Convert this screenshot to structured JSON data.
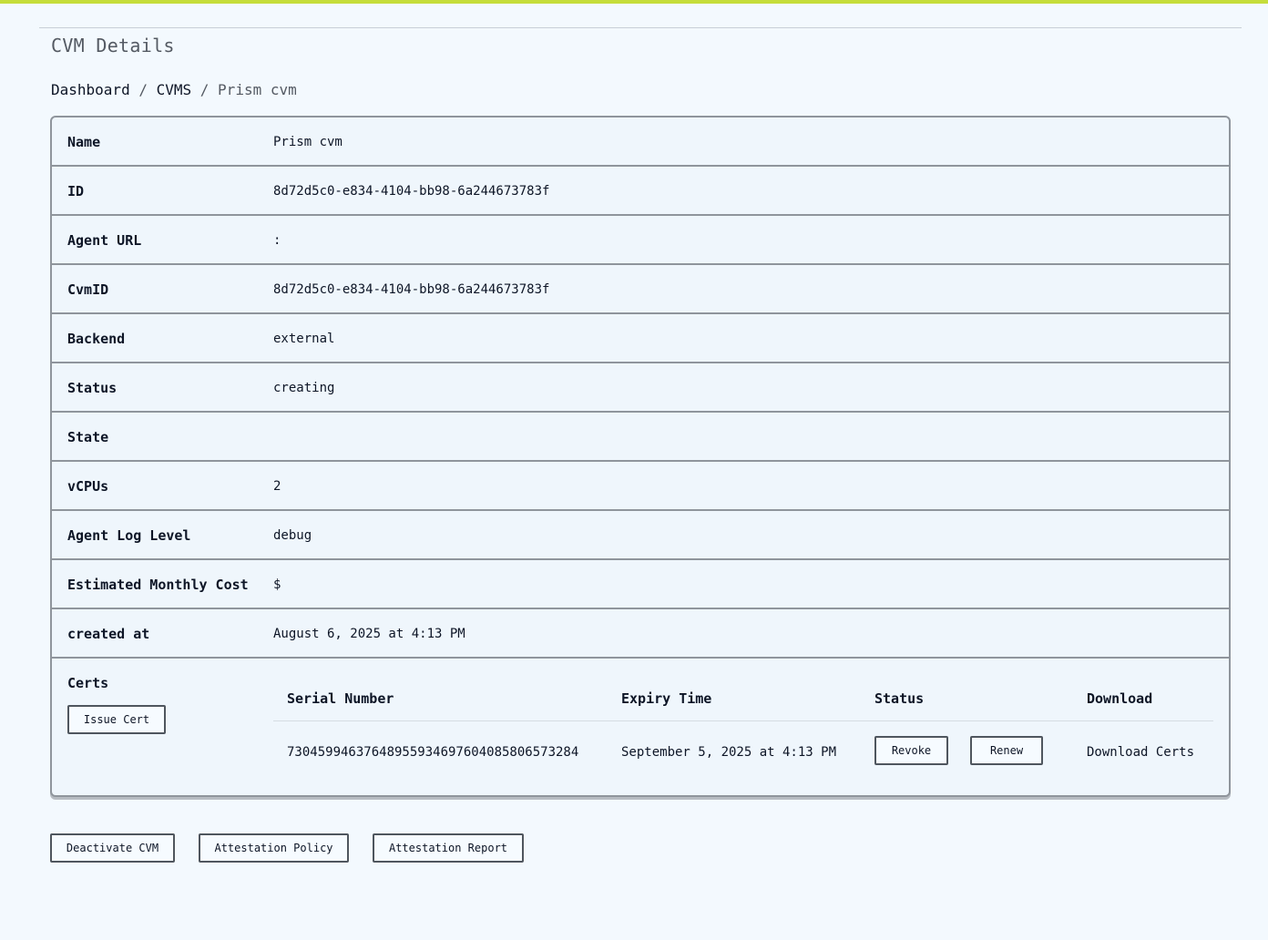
{
  "header": {
    "title": "CVM Details"
  },
  "breadcrumb": {
    "items": [
      "Dashboard",
      "CVMS"
    ],
    "separator": " / ",
    "current": "Prism cvm"
  },
  "details": {
    "rows": [
      {
        "label": "Name",
        "value": "Prism cvm"
      },
      {
        "label": "ID",
        "value": "8d72d5c0-e834-4104-bb98-6a244673783f"
      },
      {
        "label": "Agent URL",
        "value": ":"
      },
      {
        "label": "CvmID",
        "value": "8d72d5c0-e834-4104-bb98-6a244673783f"
      },
      {
        "label": "Backend",
        "value": "external"
      },
      {
        "label": "Status",
        "value": "creating"
      },
      {
        "label": "State",
        "value": ""
      },
      {
        "label": "vCPUs",
        "value": "2"
      },
      {
        "label": "Agent Log Level",
        "value": "debug"
      },
      {
        "label": "Estimated Monthly Cost",
        "value": "$"
      },
      {
        "label": "created at",
        "value": "August 6, 2025 at 4:13 PM"
      }
    ]
  },
  "certs": {
    "label": "Certs",
    "issue_button": "Issue Cert",
    "columns": [
      "Serial Number",
      "Expiry Time",
      "Status",
      "Download"
    ],
    "rows": [
      {
        "serial": "730459946376489559346976040858065732​84",
        "expiry": "September 5, 2025 at 4:13 PM",
        "revoke_label": "Revoke",
        "renew_label": "Renew",
        "download_label": "Download Certs"
      }
    ]
  },
  "actions": {
    "deactivate_label": "Deactivate CVM",
    "policy_label": "Attestation Policy",
    "report_label": "Attestation Report"
  },
  "colors": {
    "accent_bar": "#c5dd3b",
    "page_background": "#f3f9fe",
    "card_border": "#8f959c"
  }
}
